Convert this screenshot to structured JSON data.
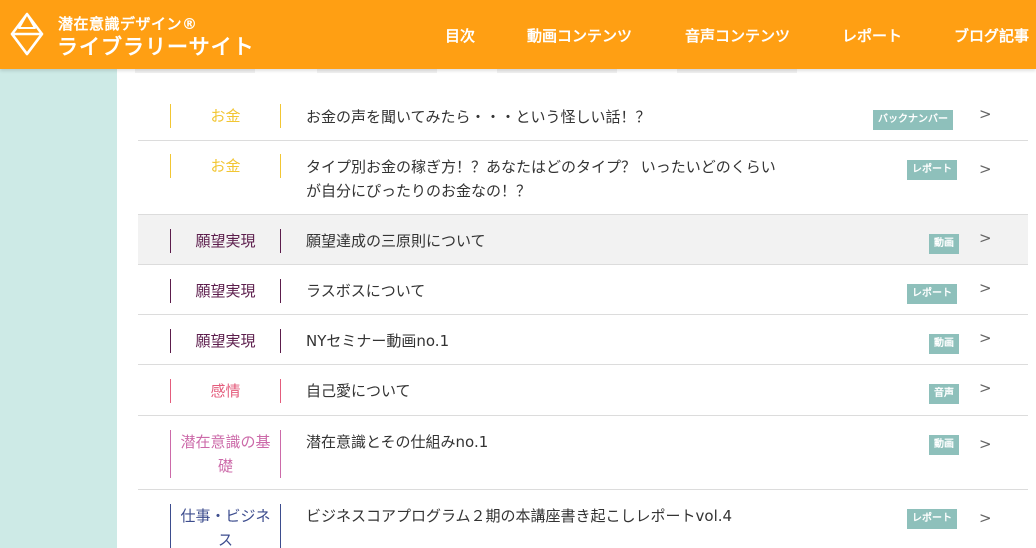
{
  "header": {
    "logo_line1": "潜在意識デザイン®",
    "logo_line2": "ライブラリーサイト",
    "background_color": "#ff9f13"
  },
  "nav": {
    "items": [
      "目次",
      "動画コンテンツ",
      "音声コンテンツ",
      "レポート",
      "ブログ記事"
    ]
  },
  "category_colors": {
    "お金": "#f2c633",
    "願望実現": "#5c1d4c",
    "感情": "#e45c7c",
    "潜在意識の基礎": "#cc6aa9",
    "仕事・ビジネス": "#3d4d8e"
  },
  "articles": [
    {
      "category": "お金",
      "title": "お金の声を聞いてみたら・・・という怪しい話！？",
      "badge": "バックナンバー",
      "chevron": ">"
    },
    {
      "category": "お金",
      "title": "タイプ別お金の稼ぎ方！？あなたはどのタイプ？ いったいどのくらいが自分にぴったりのお金なの！？",
      "badge": "レポート",
      "chevron": ">"
    },
    {
      "category": "願望実現",
      "title": "願望達成の三原則について",
      "badge": "動画",
      "chevron": ">"
    },
    {
      "category": "願望実現",
      "title": "ラスボスについて",
      "badge": "レポート",
      "chevron": ">"
    },
    {
      "category": "願望実現",
      "title": "NYセミナー動画no.1",
      "badge": "動画",
      "chevron": ">"
    },
    {
      "category": "感情",
      "title": "自己愛について",
      "badge": "音声",
      "chevron": ">"
    },
    {
      "category": "潜在意識の基礎",
      "title": "潜在意識とその仕組みno.1",
      "badge": "動画",
      "chevron": ">"
    },
    {
      "category": "仕事・ビジネス",
      "title": "ビジネスコアプログラム２期の本講座書き起こしレポートvol.4",
      "badge": "レポート",
      "chevron": ">"
    }
  ]
}
